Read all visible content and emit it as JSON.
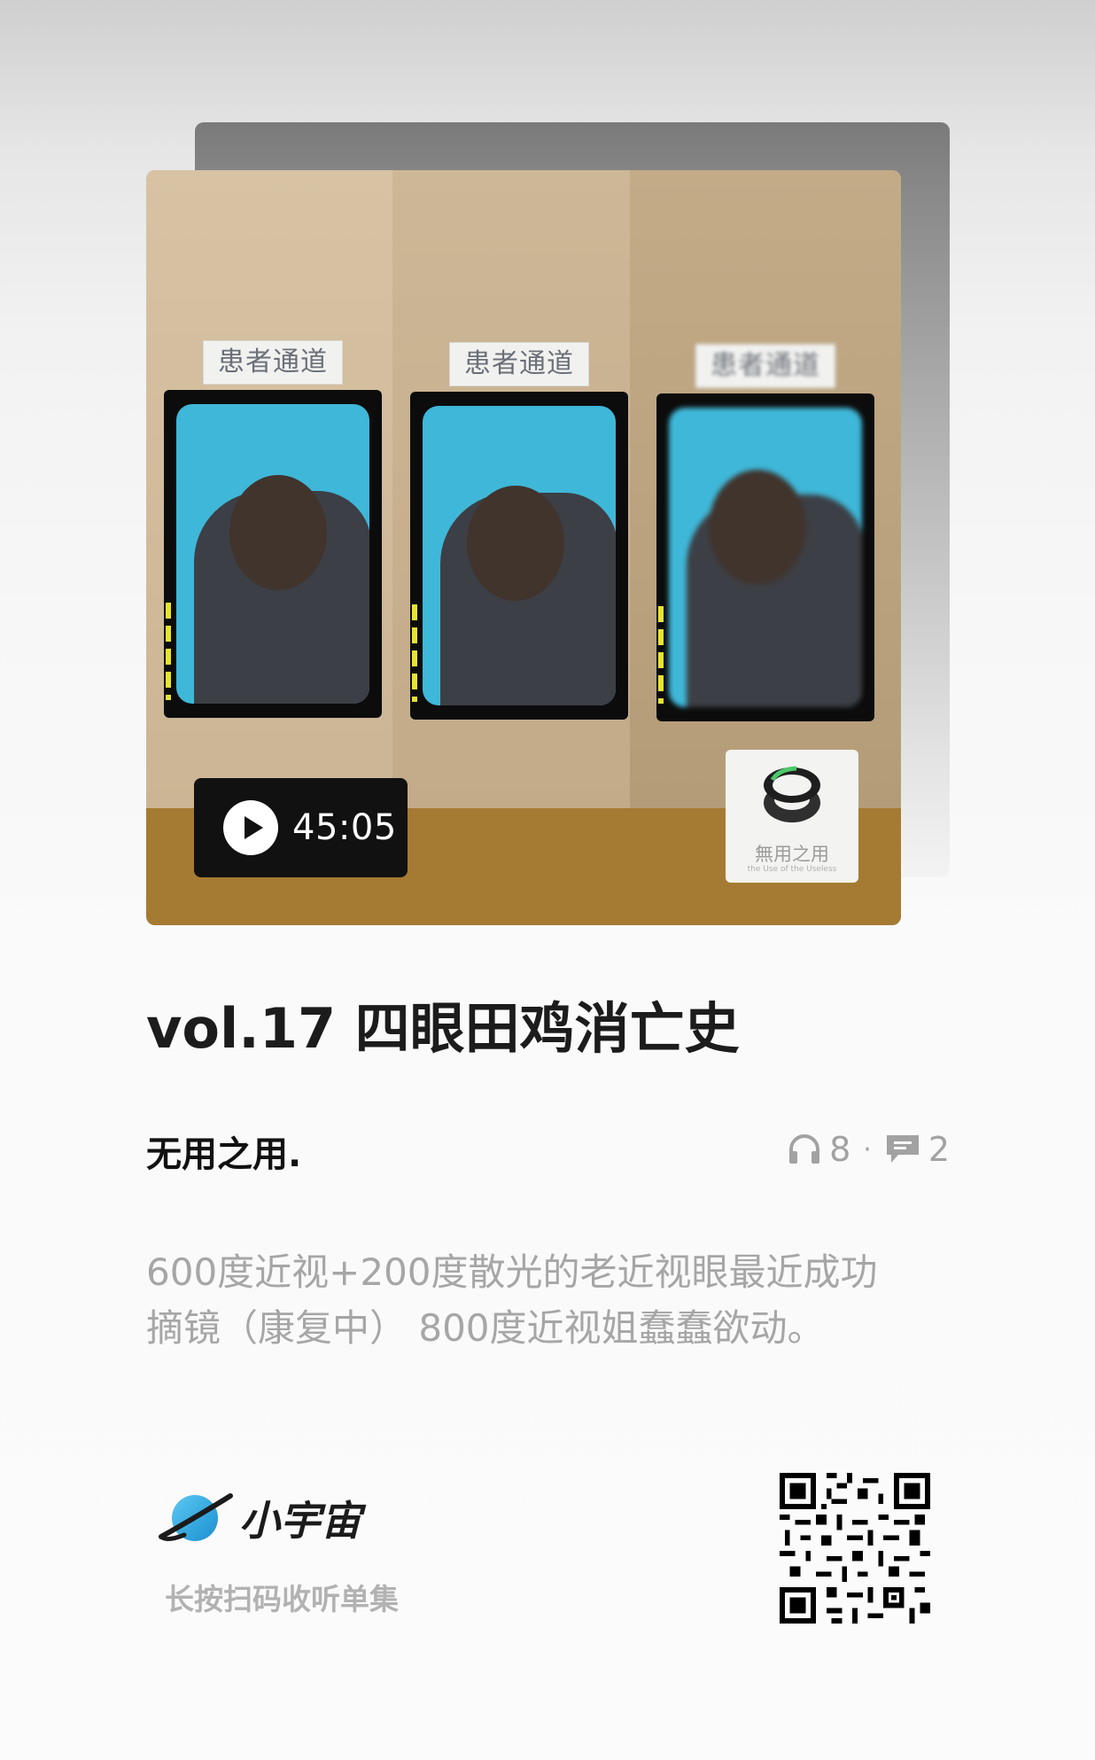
{
  "cover": {
    "sign_text": "患者通道",
    "duration": "45:05",
    "logo": {
      "name": "無用之用",
      "subtitle": "the Use of the Useless"
    }
  },
  "episode": {
    "title": "vol.17 四眼田鸡消亡史",
    "author": "无用之用.",
    "listens": "8",
    "comments": "2",
    "description_lines": [
      "600度近视+200度散光的老近视眼最近成功",
      "摘镜（康复中） 800度近视姐蠢蠢欲动。"
    ]
  },
  "footer": {
    "brand": "小宇宙",
    "scan_hint": "长按扫码收听单集"
  },
  "colors": {
    "floor": "#a57b33",
    "glass": "#3fb7d8",
    "brand_blue": "#2aa6e0"
  }
}
